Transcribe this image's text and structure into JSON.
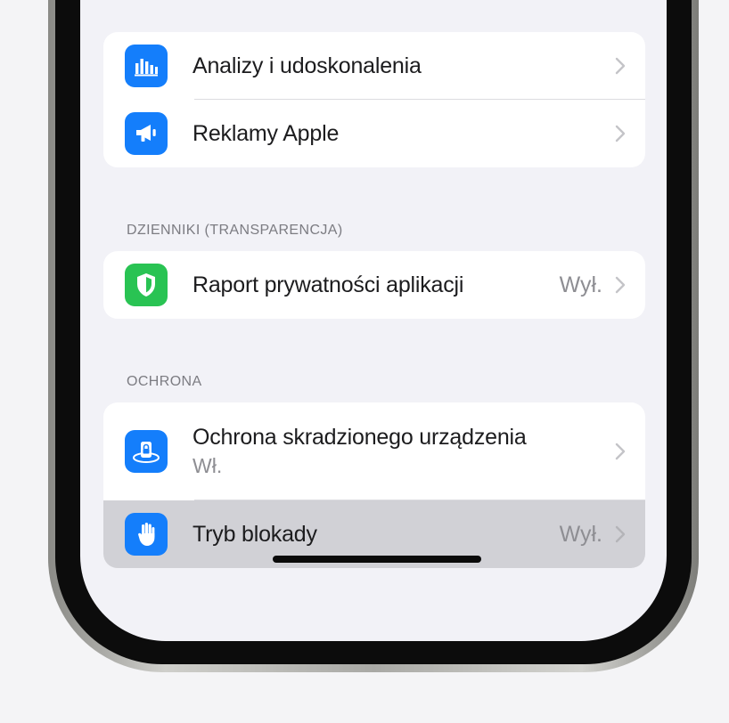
{
  "groups": {
    "top": {
      "rows": [
        {
          "label": "Analizy i udoskonalenia",
          "icon": "bar-chart-icon"
        },
        {
          "label": "Reklamy Apple",
          "icon": "megaphone-icon"
        }
      ]
    },
    "transparency": {
      "header": "DZIENNIKI (TRANSPARENCJA)",
      "rows": [
        {
          "label": "Raport prywatności aplikacji",
          "value": "Wył.",
          "icon": "shield-icon"
        }
      ]
    },
    "protection": {
      "header": "OCHRONA",
      "rows": [
        {
          "label": "Ochrona skradzionego urządzenia",
          "sublabel": "Wł.",
          "icon": "stolen-device-protection-icon"
        },
        {
          "label": "Tryb blokady",
          "value": "Wył.",
          "icon": "hand-icon"
        }
      ]
    }
  },
  "colors": {
    "icon_blue": "#147efb",
    "icon_green": "#29c353",
    "highlight": "#d1d1d6",
    "background": "#f2f2f7"
  }
}
